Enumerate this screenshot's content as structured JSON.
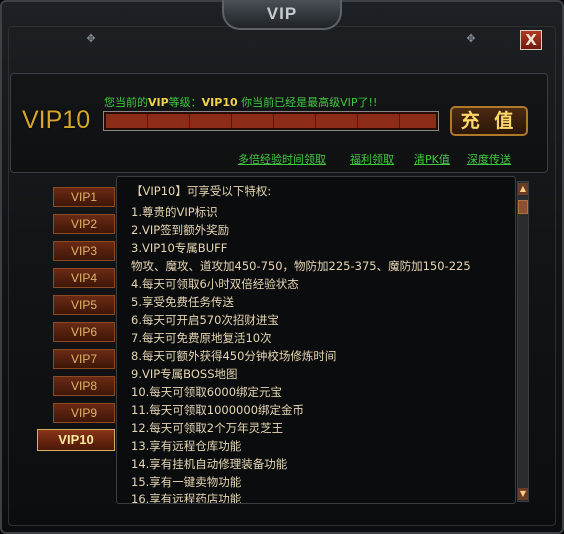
{
  "window": {
    "title": "VIP",
    "close_label": "X"
  },
  "vip_level_display": "VIP10",
  "status": {
    "prefix": "您当前的",
    "vip_word": "VIP",
    "level_label": "等级：",
    "level_value": "VIP10",
    "suffix": " 你当前已经是最高级VIP了!!"
  },
  "progress": {
    "fraction": 1.0
  },
  "charge_button_label": "充 值",
  "links": [
    {
      "label": "多倍经验时间领取"
    },
    {
      "label": "福利领取"
    },
    {
      "label": "清PK值"
    },
    {
      "label": "深度传送"
    }
  ],
  "vip_buttons": [
    {
      "label": "VIP1"
    },
    {
      "label": "VIP2"
    },
    {
      "label": "VIP3"
    },
    {
      "label": "VIP4"
    },
    {
      "label": "VIP5"
    },
    {
      "label": "VIP6"
    },
    {
      "label": "VIP7"
    },
    {
      "label": "VIP8"
    },
    {
      "label": "VIP9"
    },
    {
      "label": "VIP10",
      "selected": true
    }
  ],
  "privileges": {
    "header": "【VIP10】可享受以下特权:",
    "items": [
      "1.尊贵的VIP标识",
      "2.VIP签到额外奖励",
      "3.VIP10专属BUFF",
      "物攻、魔攻、道攻加450-750，物防加225-375、魔防加150-225",
      "4.每天可领取6小时双倍经验状态",
      "5.享受免费任务传送",
      "6.每天可开启570次招财进宝",
      "7.每天可免费原地复活10次",
      "8.每天可额外获得450分钟校场修炼时间",
      "9.VIP专属BOSS地图",
      "10.每天可领取6000绑定元宝",
      "11.每天可领取1000000绑定金币",
      "12.每天可领取2个万年灵芝王",
      "13.享有远程仓库功能",
      "14.享有挂机自动修理装备功能",
      "15.享有一键卖物功能",
      "16.享有远程药店功能"
    ]
  },
  "scrollbar": {
    "up_glyph": "▲",
    "down_glyph": "▼"
  },
  "icons": {
    "rivet": "✥"
  },
  "colors": {
    "accent_gold": "#d6a62a",
    "link_green": "#3ecb3e",
    "text_cream": "#e6d6b4"
  }
}
